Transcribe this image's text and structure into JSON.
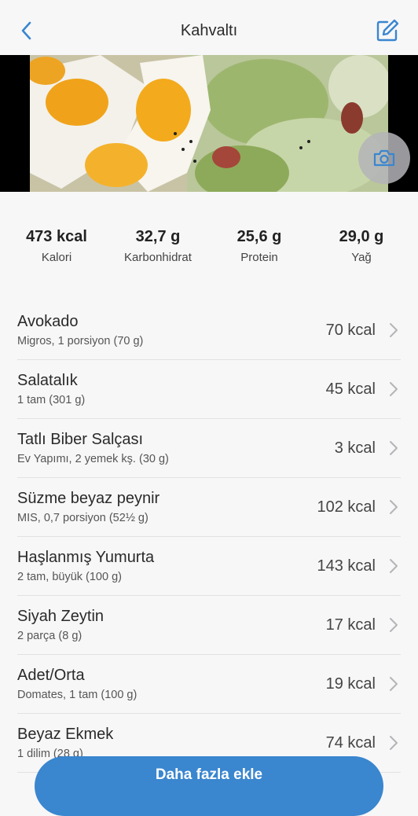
{
  "header": {
    "title": "Kahvaltı"
  },
  "totals": {
    "calories": {
      "value": "473 kcal",
      "label": "Kalori"
    },
    "carbs": {
      "value": "32,7 g",
      "label": "Karbonhidrat"
    },
    "protein": {
      "value": "25,6 g",
      "label": "Protein"
    },
    "fat": {
      "value": "29,0 g",
      "label": "Yağ"
    }
  },
  "foods": [
    {
      "name": "Avokado",
      "detail": "Migros, 1 porsiyon (70 g)",
      "kcal": "70 kcal"
    },
    {
      "name": "Salatalık",
      "detail": "1 tam (301 g)",
      "kcal": "45 kcal"
    },
    {
      "name": "Tatlı Biber Salçası",
      "detail": "Ev Yapımı, 2 yemek kş.  (30 g)",
      "kcal": "3 kcal"
    },
    {
      "name": "Süzme beyaz peynir",
      "detail": "MIS, 0,7 porsiyon (52½ g)",
      "kcal": "102 kcal"
    },
    {
      "name": "Haşlanmış Yumurta",
      "detail": "2 tam, büyük (100 g)",
      "kcal": "143 kcal"
    },
    {
      "name": "Siyah Zeytin",
      "detail": "2 parça (8 g)",
      "kcal": "17 kcal"
    },
    {
      "name": "Adet/Orta",
      "detail": "Domates, 1 tam (100 g)",
      "kcal": "19 kcal"
    },
    {
      "name": "Beyaz Ekmek",
      "detail": "1 dilim (28 g)",
      "kcal": "74 kcal"
    }
  ],
  "actions": {
    "add_more": "Daha fazla ekle"
  },
  "colors": {
    "accent": "#3a86cf",
    "background": "#f7f7f8"
  },
  "icons": {
    "back": "chevron-left-icon",
    "edit": "edit-icon",
    "camera": "camera-icon",
    "row": "chevron-right-icon"
  }
}
